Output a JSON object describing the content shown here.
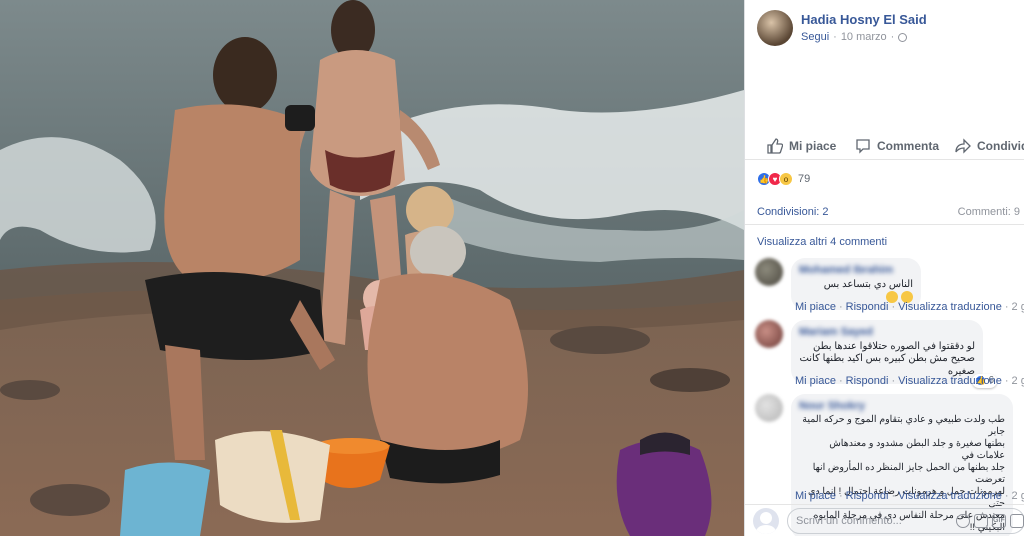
{
  "post": {
    "author": "Hadia Hosny El Said",
    "follow_label": "Segui",
    "date": "10 marzo",
    "separator": "·"
  },
  "actions": {
    "like": "Mi piace",
    "comment": "Commenta",
    "share": "Condividi"
  },
  "reactions": {
    "count": "79",
    "types": [
      "like-icon",
      "love-icon",
      "wow-icon"
    ]
  },
  "stats": {
    "shares": "Condivisioni: 2",
    "comments": "Commenti: 9"
  },
  "view_more": "Visualizza altri 4 commenti",
  "comments": [
    {
      "name": "Mohamed Ibrahim",
      "text": "الناس دي بتساعد بس",
      "like": "Mi piace",
      "reply": "Rispondi",
      "translate": "Visualizza traduzione",
      "age": "2 g"
    },
    {
      "name": "Mariam Sayed",
      "text_lines": [
        "لو دققتوا في الصوره حتلاقوا عندها بطن",
        "صحيح مش بطن كبيره بس اكيد بطنها كانت صغيره"
      ],
      "reaction_count": "6",
      "like": "Mi piace",
      "reply": "Rispondi",
      "translate": "Visualizza traduzione",
      "age": "2 g"
    },
    {
      "name": "Nour Shokry",
      "text_lines": [
        "طب ولدت طبيعي و عادي بتقاوم الموج و حركه المية جابر",
        "بطنها صغيرة و جلد البطن مشدود و معندهاش علامات في",
        "جلد بطنها من الحمل جايز المنظر ده المأروض انها تعرضت",
        "لهرمونات حمل و هرمونات رضاعة احتمال ! إنما دي حتى",
        "معندش على مرحلة النفاس دي في مرحلة المايوه البكيني !!"
      ],
      "like": "Mi piace",
      "reply": "Rispondi",
      "translate": "Visualizza traduzione",
      "age": "2 g"
    }
  ],
  "composer": {
    "placeholder": "Scrivi un commento...",
    "icons": [
      "emoji-icon",
      "camera-icon",
      "gif-icon",
      "sticker-icon"
    ],
    "gif_label": "GIF"
  }
}
